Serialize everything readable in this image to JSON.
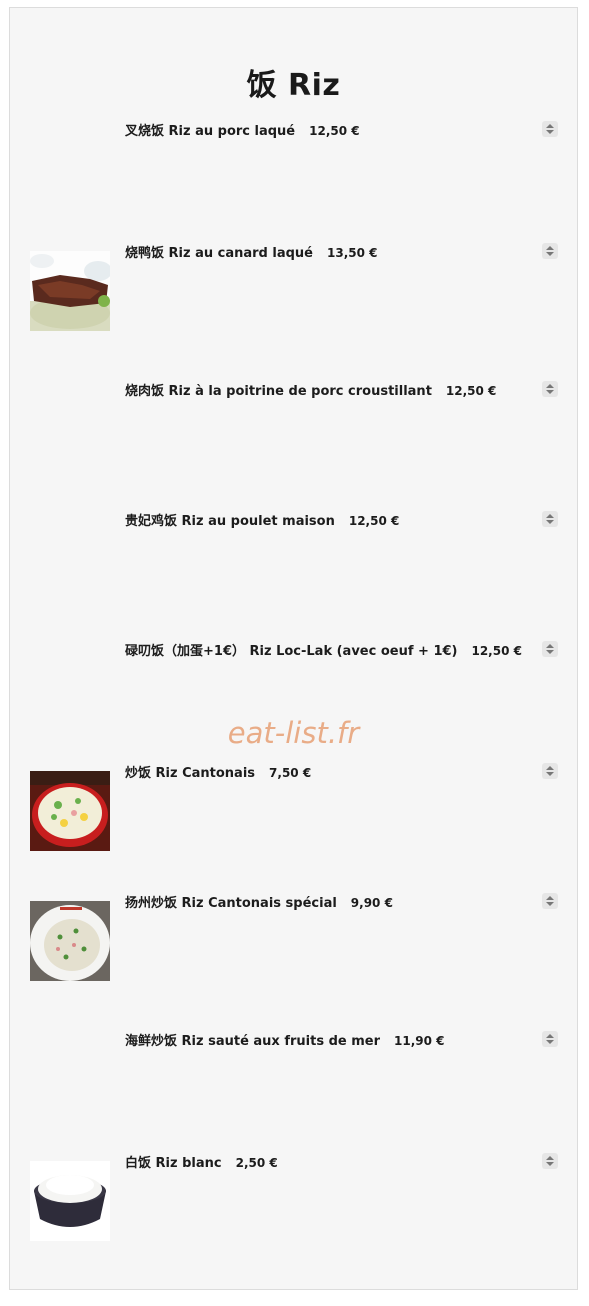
{
  "menu": {
    "title": "饭 Riz",
    "watermark": "eat-list.fr",
    "items": [
      {
        "name": "叉烧饭 Riz au porc laqué",
        "price": "12,50 €"
      },
      {
        "name": "烧鸭饭 Riz au canard laqué",
        "price": "13,50 €"
      },
      {
        "name": "烧肉饭 Riz à la poitrine de porc croustillant",
        "price": "12,50 €"
      },
      {
        "name": "贵妃鸡饭 Riz au poulet maison",
        "price": "12,50 €"
      },
      {
        "name": "碌叨饭（加蛋+1€） Riz Loc-Lak (avec oeuf + 1€)",
        "price": "12,50 €"
      },
      {
        "name": "炒饭 Riz Cantonais",
        "price": "7,50 €"
      },
      {
        "name": "扬州炒饭 Riz Cantonais spécial",
        "price": "9,90 €"
      },
      {
        "name": "海鲜炒饭 Riz sauté aux fruits de mer",
        "price": "11,90 €"
      },
      {
        "name": "白饭 Riz blanc",
        "price": "2,50 €"
      }
    ]
  }
}
